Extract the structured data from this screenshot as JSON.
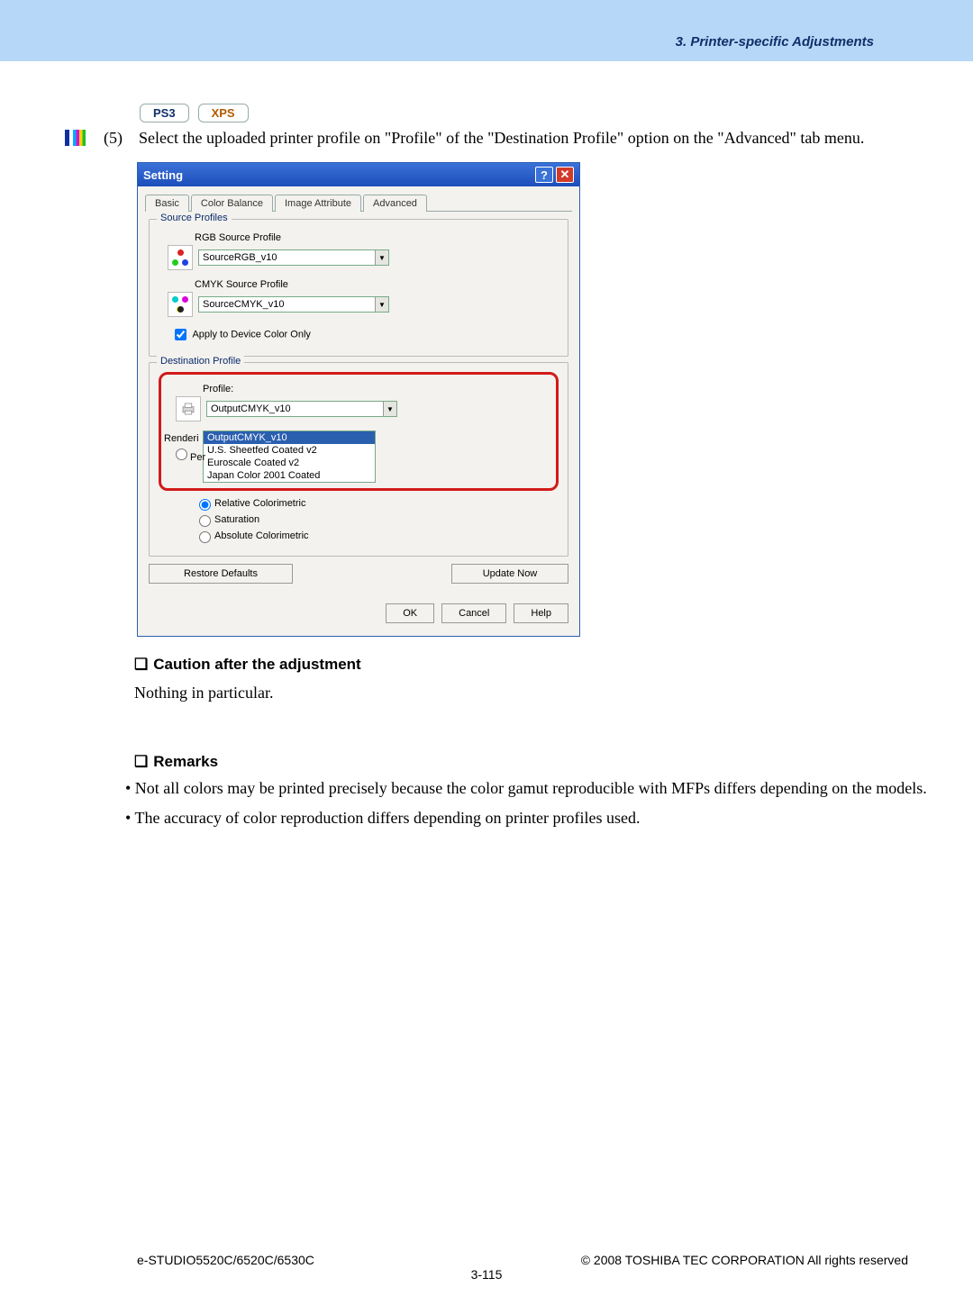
{
  "header": {
    "title": "3. Printer-specific Adjustments"
  },
  "tags": {
    "a": "PS3",
    "b": "XPS"
  },
  "step": {
    "num": "(5)",
    "text": "Select the uploaded printer profile on \"Profile\" of the \"Destination Profile\" option on the \"Advanced\" tab menu."
  },
  "dialog": {
    "title": "Setting",
    "help": "?",
    "close": "✕",
    "tabs": [
      "Basic",
      "Color Balance",
      "Image Attribute",
      "Advanced"
    ],
    "source_group": "Source Profiles",
    "rgb_label": "RGB Source Profile",
    "rgb_value": "SourceRGB_v10",
    "cmyk_label": "CMYK Source Profile",
    "cmyk_value": "SourceCMYK_v10",
    "apply_device": "Apply to Device Color Only",
    "dest_group": "Destination Profile",
    "profile_label": "Profile:",
    "profile_value": "OutputCMYK_v10",
    "profile_options": [
      "OutputCMYK_v10",
      "U.S. Sheetfed Coated v2",
      "Euroscale Coated v2",
      "Japan Color 2001 Coated"
    ],
    "rendering_prefix": "Renderi",
    "per_prefix": "Per",
    "intents": [
      "Relative Colorimetric",
      "Saturation",
      "Absolute Colorimetric"
    ],
    "restore": "Restore Defaults",
    "update": "Update Now",
    "ok": "OK",
    "cancel": "Cancel",
    "help_btn": "Help"
  },
  "caution": {
    "heading": "Caution after the adjustment",
    "body": "Nothing in particular."
  },
  "remarks": {
    "heading": "Remarks",
    "b1": "• Not all colors may be printed precisely because the color gamut reproducible with MFPs differs depending on the models.",
    "b2": "• The accuracy of color reproduction differs depending on printer profiles used."
  },
  "footer": {
    "left": "e-STUDIO5520C/6520C/6530C",
    "right": "© 2008 TOSHIBA TEC CORPORATION All rights reserved",
    "page": "3-115"
  }
}
